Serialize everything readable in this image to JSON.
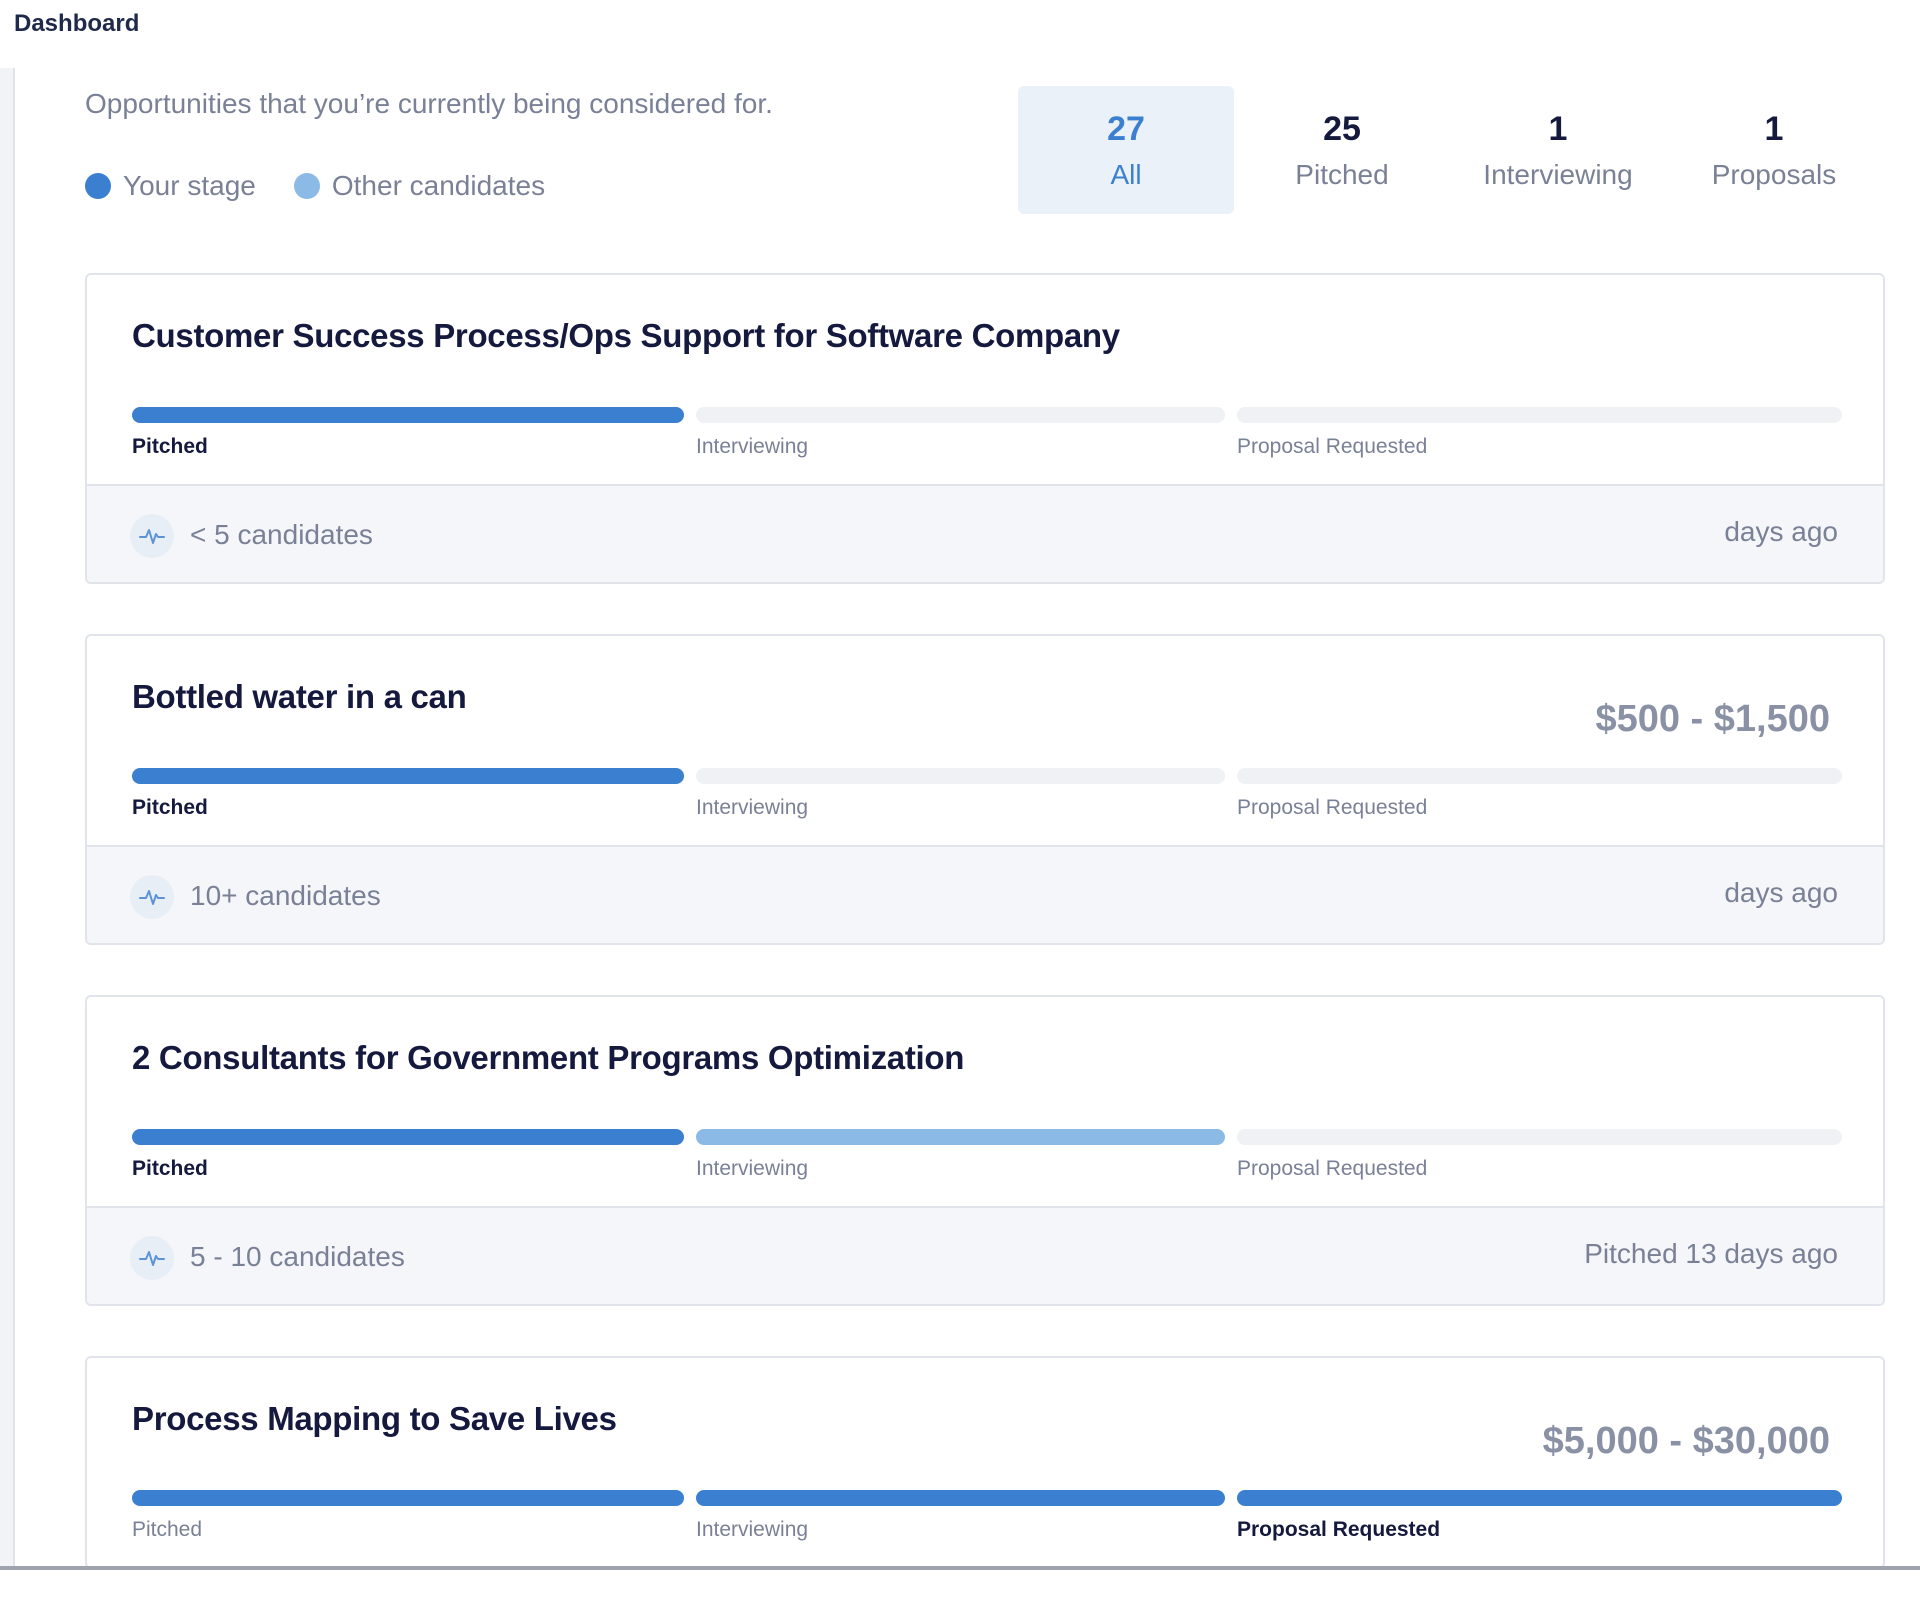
{
  "header": {
    "title": "Dashboard"
  },
  "intro": {
    "subtitle": "Opportunities that you’re currently being considered for.",
    "legend": [
      {
        "label": "Your stage",
        "color": "#3b7fd1"
      },
      {
        "label": "Other candidates",
        "color": "#8cbae6"
      }
    ]
  },
  "filters": [
    {
      "count": "27",
      "label": "All",
      "active": true
    },
    {
      "count": "25",
      "label": "Pitched",
      "active": false
    },
    {
      "count": "1",
      "label": "Interviewing",
      "active": false
    },
    {
      "count": "1",
      "label": "Proposals",
      "active": false
    }
  ],
  "stage_names": [
    "Pitched",
    "Interviewing",
    "Proposal Requested"
  ],
  "cards": [
    {
      "title": "Customer Success Process/Ops Support for Software Company",
      "budget": "",
      "stage_fill": [
        "you",
        "none",
        "none"
      ],
      "current_stage": 0,
      "candidates": "< 5 candidates",
      "when": "days ago"
    },
    {
      "title": "Bottled water in a can",
      "budget": "$500 - $1,500",
      "stage_fill": [
        "you",
        "none",
        "none"
      ],
      "current_stage": 0,
      "candidates": "10+ candidates",
      "when": "days ago"
    },
    {
      "title": "2 Consultants for Government Programs Optimization",
      "budget": "",
      "stage_fill": [
        "you",
        "other",
        "none"
      ],
      "current_stage": 0,
      "candidates": "5 - 10 candidates",
      "when": "Pitched 13 days ago"
    },
    {
      "title": "Process Mapping to Save Lives",
      "budget": "$5,000 - $30,000",
      "stage_fill": [
        "you",
        "you",
        "you"
      ],
      "current_stage": 2,
      "candidates": "",
      "when": ""
    }
  ],
  "icons": {
    "activity": "pulse-icon"
  },
  "colors": {
    "accent": "#3b7fd1",
    "other": "#8cbae6",
    "text": "#14193d",
    "muted": "#7a8196"
  }
}
